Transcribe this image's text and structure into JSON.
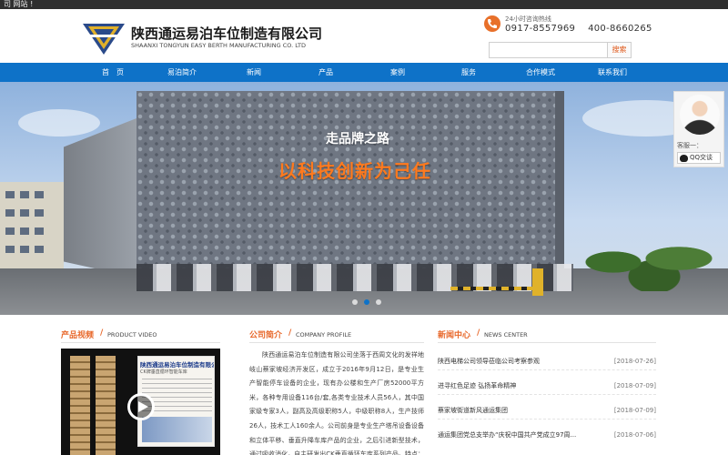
{
  "topbar": {
    "text": "司 网站 !"
  },
  "header": {
    "company_cn": "陕西通运易泊车位制造有限公司",
    "company_en": "SHAANXI TONGYUN EASY BERTH MANUFACTURING CO. LTD",
    "hotline_label": "24小时咨询热线",
    "hotline_numbers": "0917-8557969    400-8660265",
    "search_placeholder": "",
    "search_button": "搜索"
  },
  "nav": {
    "items": [
      {
        "label": "首　页"
      },
      {
        "label": "易泊简介"
      },
      {
        "label": "新闻"
      },
      {
        "label": "产品"
      },
      {
        "label": "案例"
      },
      {
        "label": "服务"
      },
      {
        "label": "合作模式"
      },
      {
        "label": "联系我们"
      }
    ]
  },
  "banner": {
    "subtitle": "走品牌之路",
    "headline": "以科技创新为己任"
  },
  "service": {
    "label": "客服一：",
    "qq_label": "QQ交谈"
  },
  "video_section": {
    "title": "产品视频",
    "subtitle": "PRODUCT VIDEO",
    "card_title": "陕西通运易泊车位制造有限公司",
    "card_sub": "CK牌垂直循环智能车库"
  },
  "profile_section": {
    "title": "公司简介",
    "subtitle": "COMPANY PROFILE",
    "text": "陕西通运易泊车位制造有限公司坐落于西周文化的发祥地岐山蔡家坡经济开发区，成立于2016年9月12日，是专业生产智能停车设备的企业，现有办公楼和生产厂房52000平方米，各种专用设备116台/套,各类专业技术人员56人，其中国家级专家3人，副高及高级职称5人，中级职称8人，生产技师26人，技术工人160余人。公司前身是专业生产塔吊设备设备和立体平移、垂直升降车库产品的企业，之后引进新型技术，通过吸收消化，自主研发出CK垂直循环车库系列产品。特点：无噪声，节能环保"
  },
  "news_section": {
    "title": "新闻中心",
    "subtitle": "NEWS CENTER",
    "items": [
      {
        "title": "陕西电梯公司领导莅临公司考察参观",
        "date": "[2018-07-26]"
      },
      {
        "title": "进寻红色足迹  弘扬革命精神",
        "date": "[2018-07-09]"
      },
      {
        "title": "蔡家坡街道新风通运集团",
        "date": "[2018-07-09]"
      },
      {
        "title": "通运集团党总支举办“庆祝中国共产党成立97周...",
        "date": "[2018-07-06]"
      }
    ]
  },
  "colors": {
    "nav_blue": "#0e72c8",
    "accent_orange": "#e8692c",
    "headline_orange": "#ff7a1e"
  }
}
